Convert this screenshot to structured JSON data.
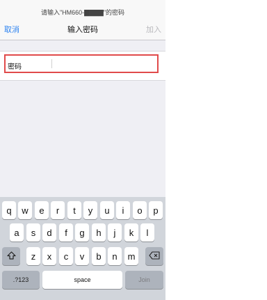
{
  "header": {
    "prompt": "请输入\"HM660-▇▇▇▇\"的密码",
    "cancel_label": "取消",
    "title": "输入密码",
    "join_label": "加入"
  },
  "form": {
    "password_label": "密码",
    "password_value": "",
    "password_placeholder": ""
  },
  "keyboard": {
    "row1": [
      "q",
      "w",
      "e",
      "r",
      "t",
      "y",
      "u",
      "i",
      "o",
      "p"
    ],
    "row2": [
      "a",
      "s",
      "d",
      "f",
      "g",
      "h",
      "j",
      "k",
      "l"
    ],
    "row3": [
      "z",
      "x",
      "c",
      "v",
      "b",
      "n",
      "m"
    ],
    "numbers_label": ".?123",
    "space_label": "space",
    "join_label": "Join"
  },
  "icons": {
    "shift": "shift-icon",
    "delete": "backspace-icon"
  },
  "colors": {
    "accent": "#2d83f0",
    "highlight_border": "#e04a4a",
    "disabled": "#b9b9bd"
  }
}
